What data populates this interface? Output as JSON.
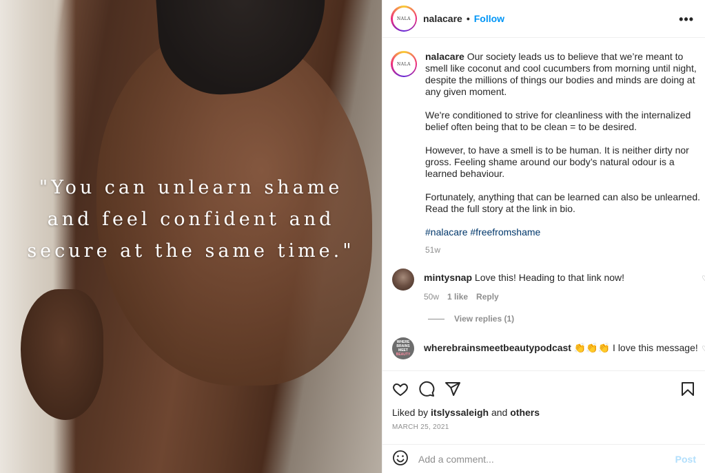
{
  "media": {
    "quote": "\"You can unlearn shame and feel confident and secure at the same time.\""
  },
  "header": {
    "avatar_text": "NALA",
    "username": "nalacare",
    "separator": "•",
    "follow_label": "Follow",
    "more_label": "•••"
  },
  "caption": {
    "username": "nalacare",
    "paragraph1": "Our society leads us to believe that we’re meant to smell like coconut and cool cucumbers from morning until night, despite the millions of things our bodies and minds are doing at any given moment.",
    "paragraph2": "We're conditioned to strive for cleanliness with the internalized belief often being that to be clean = to be desired.",
    "paragraph3": "However, to have a smell is to be human. It is neither dirty nor gross. Feeling shame around our body’s natural odour is a learned behaviour.",
    "paragraph4": "Fortunately, anything that can be learned can also be unlearned. Read the full story at the link in bio.",
    "hashtags": "#nalacare #freefromshame",
    "age": "51w"
  },
  "comments": [
    {
      "username": "mintysnap",
      "text": "Love this! Heading to that link now!",
      "age": "50w",
      "likes": "1 like",
      "reply_label": "Reply",
      "view_replies": "View replies (1)"
    },
    {
      "username": "wherebrainsmeetbeautypodcast",
      "text": "👏👏👏 I love this message!",
      "avatar_lines": [
        "WHERE",
        "BRAINS",
        "MEET",
        "BEAUTY"
      ]
    }
  ],
  "likes": {
    "prefix": "Liked by",
    "user": "itslyssaleigh",
    "and": "and",
    "others": "others"
  },
  "date": "MARCH 25, 2021",
  "add_comment": {
    "placeholder": "Add a comment...",
    "post_label": "Post"
  }
}
